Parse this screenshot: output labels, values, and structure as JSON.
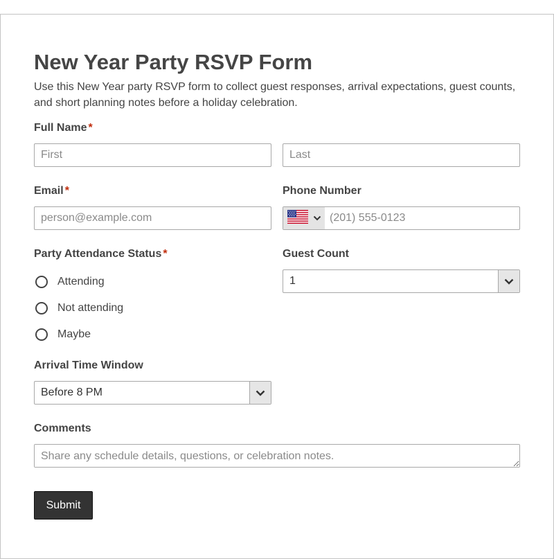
{
  "form": {
    "title": "New Year Party RSVP Form",
    "description": "Use this New Year party RSVP form to collect guest responses, arrival expectations, guest counts, and short planning notes before a holiday celebration.",
    "required_marker": "*"
  },
  "full_name": {
    "label": "Full Name",
    "first_placeholder": "First",
    "last_placeholder": "Last",
    "first_value": "",
    "last_value": ""
  },
  "email": {
    "label": "Email",
    "placeholder": "person@example.com",
    "value": ""
  },
  "phone": {
    "label": "Phone Number",
    "placeholder": "(201) 555-0123",
    "value": "",
    "country_icon": "us-flag-icon"
  },
  "attendance": {
    "label": "Party Attendance Status",
    "options": [
      "Attending",
      "Not attending",
      "Maybe"
    ]
  },
  "guest_count": {
    "label": "Guest Count",
    "selected": "1"
  },
  "arrival": {
    "label": "Arrival Time Window",
    "selected": "Before 8 PM"
  },
  "comments": {
    "label": "Comments",
    "placeholder": "Share any schedule details, questions, or celebration notes.",
    "value": ""
  },
  "submit": {
    "label": "Submit"
  },
  "colors": {
    "required": "#c02b0a",
    "button_bg": "#333333",
    "border": "#a8a8a8",
    "select_arrow_bg": "#e6e6e6"
  }
}
